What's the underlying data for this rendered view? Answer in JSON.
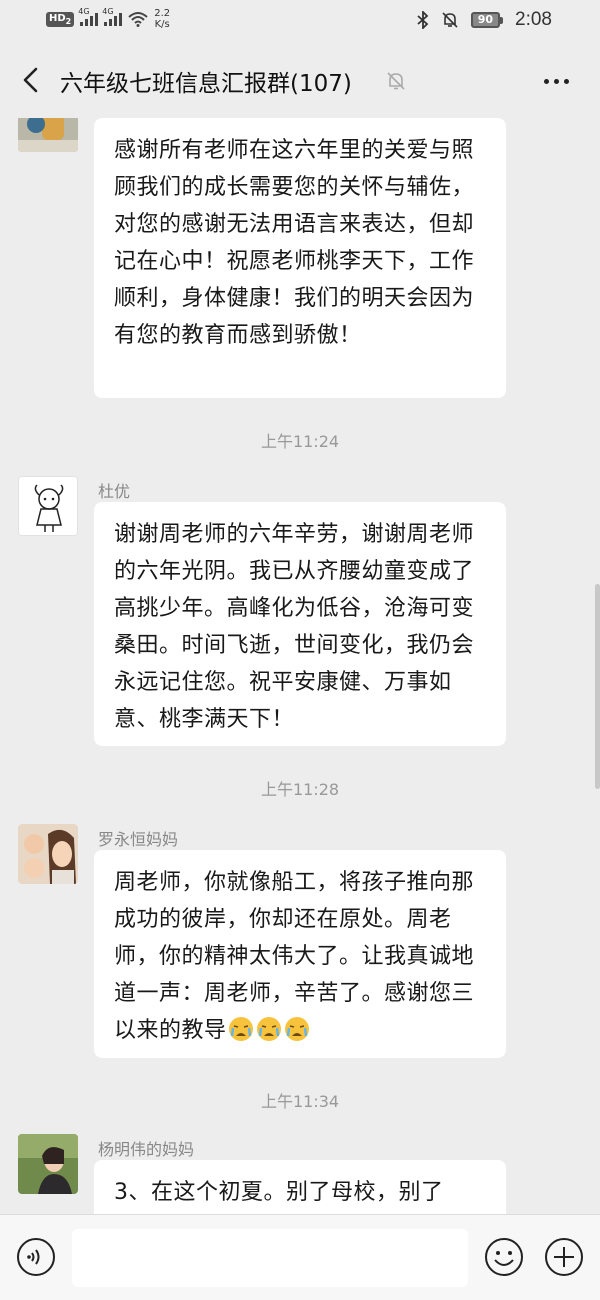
{
  "status_bar": {
    "hd_label": "HD",
    "hd_sub": "2",
    "signal1_label": "4G",
    "signal2_label": "4G",
    "speed_value": "2.2",
    "speed_unit": "K/s",
    "battery": "90",
    "time": "2:08"
  },
  "header": {
    "title": "六年级七班信息汇报群(107)"
  },
  "messages": [
    {
      "sender": "",
      "text": "感谢所有老师在这六年里的关爱与照顾我们的成长需要您的关怀与辅佐，对您的感谢无法用语言来表达，但却记在心中！祝愿老师桃李天下，工作顺利，身体健康！我们的明天会因为有您的教育而感到骄傲！"
    },
    {
      "timestamp": "上午11:24",
      "sender": "杜优",
      "text": "谢谢周老师的六年辛劳，谢谢周老师的六年光阴。我已从齐腰幼童变成了高挑少年。高峰化为低谷，沧海可变桑田。时间飞逝，世间变化，我仍会永远记住您。祝平安康健、万事如意、桃李满天下！"
    },
    {
      "timestamp": "上午11:28",
      "sender": "罗永恒妈妈",
      "text": "周老师，你就像船工，将孩子推向那成功的彼岸，你却还在原处。周老师，你的精神太伟大了。让我真诚地道一声：周老师，辛苦了。感谢您三以来的教导"
    },
    {
      "timestamp": "上午11:34",
      "sender": "杨明伟的妈妈",
      "text": "3、在这个初夏。别了母校，别了"
    }
  ],
  "input": {
    "placeholder": ""
  }
}
